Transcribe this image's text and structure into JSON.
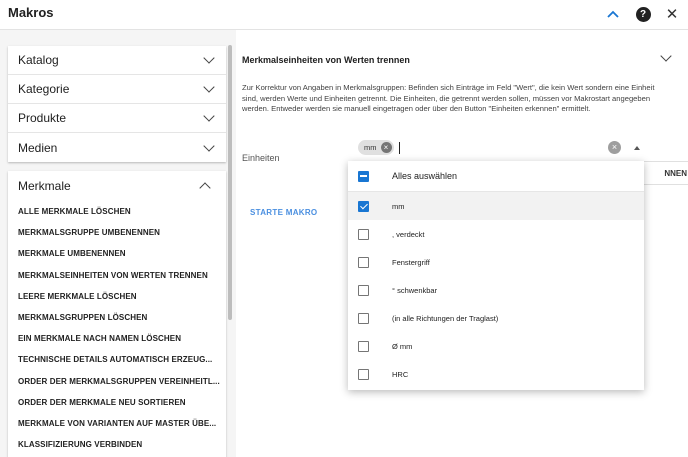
{
  "header": {
    "title": "Makros",
    "collapse_icon": "chevron-up-icon",
    "help_label": "?",
    "close_label": "✕"
  },
  "nav": {
    "items": [
      {
        "label": "Katalog"
      },
      {
        "label": "Kategorie"
      },
      {
        "label": "Produkte"
      },
      {
        "label": "Medien"
      }
    ]
  },
  "merkmale": {
    "title": "Merkmale",
    "macros": [
      "ALLE MERKMALE LÖSCHEN",
      "MERKMALSGRUPPE UMBENENNEN",
      "MERKMALE UMBENENNEN",
      "MERKMALSEINHEITEN VON WERTEN TRENNEN",
      "LEERE MERKMALE LÖSCHEN",
      "MERKMALSGRUPPEN LÖSCHEN",
      "EIN MERKMALE NACH NAMEN LÖSCHEN",
      "TECHNISCHE DETAILS AUTOMATISCH ERZEUG...",
      "ORDER DER MERKMALSGRUPPEN VEREINHEITL...",
      "ORDER DER MERKMALE NEU SORTIEREN",
      "MERKMALE VON VARIANTEN AUF MASTER ÜBE...",
      "KLASSIFIZIERUNG VERBINDEN"
    ]
  },
  "section": {
    "title": "Merkmalseinheiten von Werten trennen",
    "description": "Zur Korrektur von Angaben in Merkmalsgruppen: Befinden sich Einträge im Feld \"Wert\", die kein Wert sondern eine Einheit sind, werden Werte und Einheiten getrennt. Die Einheiten, die getrennt werden sollen, müssen vor Makrostart angegeben werden. Entweder werden sie manuell eingetragen oder über den Button \"Einheiten erkennen\" ermittelt.",
    "einheiten_label": "Einheiten",
    "chip": "mm",
    "partial_button": "NNEN",
    "start_button": "STARTE MAKRO"
  },
  "dropdown": {
    "select_all": "Alles auswählen",
    "options": [
      {
        "label": "mm",
        "checked": true
      },
      {
        "label": ", verdeckt",
        "checked": false
      },
      {
        "label": "Fenstergriff",
        "checked": false
      },
      {
        "label": "° schwenkbar",
        "checked": false
      },
      {
        "label": "(in alle Richtungen der Traglast)",
        "checked": false
      },
      {
        "label": "Ø mm",
        "checked": false
      },
      {
        "label": "HRC",
        "checked": false
      }
    ]
  },
  "colors": {
    "accent": "#1976d2",
    "start_button": "#4a8fe0"
  }
}
